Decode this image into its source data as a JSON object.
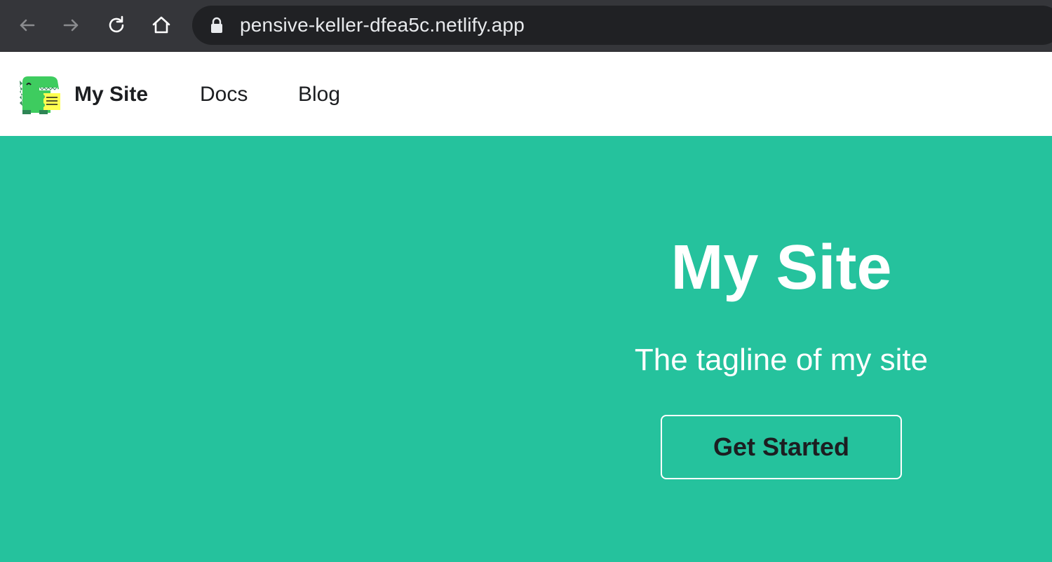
{
  "browser": {
    "url": "pensive-keller-dfea5c.netlify.app",
    "icons": [
      "back-arrow-icon",
      "forward-arrow-icon",
      "reload-icon",
      "home-icon",
      "lock-icon"
    ],
    "chrome_color": "#35363a",
    "urlbar_color": "#202124"
  },
  "navbar": {
    "brand_title": "My Site",
    "links": [
      {
        "label": "Docs"
      },
      {
        "label": "Blog"
      }
    ],
    "logo_icon": "docusaurus-dinosaur-logo"
  },
  "hero": {
    "title": "My Site",
    "tagline": "The tagline of my site",
    "button_label": "Get Started",
    "background_color": "#25c29d"
  }
}
